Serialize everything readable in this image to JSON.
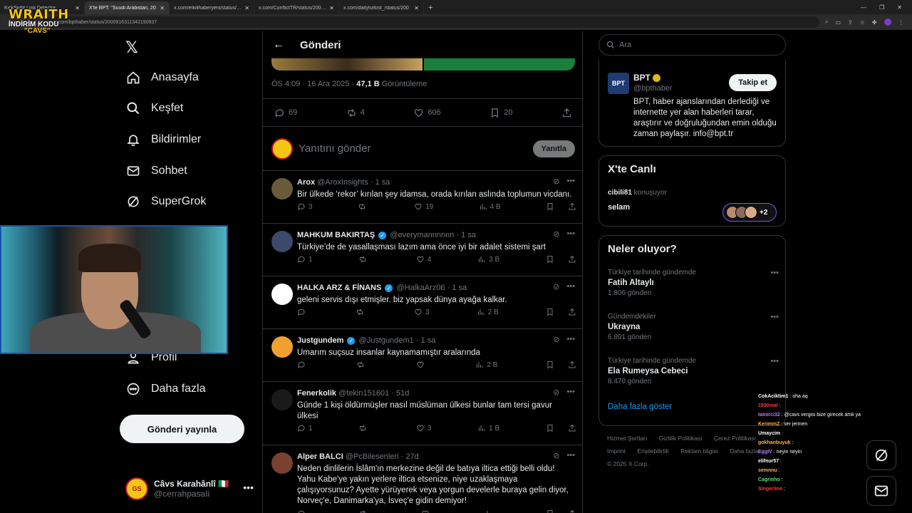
{
  "browser": {
    "tabs": [
      {
        "label": "KickSight Link Detector",
        "active": false
      },
      {
        "label": "X'te BPT: \"Suudi Arabistan, 20",
        "active": true
      },
      {
        "label": "x.com/etkilihaberyeni/status/20",
        "active": false
      },
      {
        "label": "x.com/ConflictTR/status/20008",
        "active": false
      },
      {
        "label": "x.com/dailyturkist_/status/200",
        "active": false
      }
    ],
    "url": "x.com/bpthaber/status/2000916311342190937"
  },
  "overlay": {
    "logo_line1": "WRAITH",
    "logo_line2": "İNDİRİM KODU",
    "logo_line3": "\"CAVS\""
  },
  "nav": {
    "items": [
      {
        "label": "Anasayfa",
        "icon": "home-icon"
      },
      {
        "label": "Keşfet",
        "icon": "search-icon"
      },
      {
        "label": "Bildirimler",
        "icon": "bell-icon"
      },
      {
        "label": "Sohbet",
        "icon": "mail-icon"
      },
      {
        "label": "SuperGrok",
        "icon": "grok-icon"
      },
      {
        "label": "Profil",
        "icon": "person-icon"
      },
      {
        "label": "Daha fazla",
        "icon": "more-circle-icon"
      }
    ],
    "post_button": "Gönderi yayınla",
    "account": {
      "name": "Câvs Karahânlî 🇮🇹",
      "handle": "@cerrahpasaIi"
    }
  },
  "main": {
    "title": "Gönderi",
    "meta": {
      "time": "ÖS 4:09 · 16 Ara 2025 · ",
      "views": "47,1 B",
      "views_label": " Görüntüleme"
    },
    "stats": {
      "replies": "69",
      "reposts": "4",
      "likes": "606",
      "bookmarks": "20"
    },
    "reply_placeholder": "Yanıtını gönder",
    "reply_button": "Yanıtla",
    "replies": [
      {
        "name": "Arox",
        "handle": "@AroxInsights",
        "time": "· 1 sa",
        "text": "Bir ülkede ‘rekor’ kırılan şey idamsa, orada kırılan aslında toplumun vicdanı.",
        "replies": "3",
        "reposts": "",
        "likes": "19",
        "views": "4 B",
        "verified": false
      },
      {
        "name": "MAHKUM BAKIRTAŞ",
        "handle": "@everymannnnnn",
        "time": "· 1 sa",
        "text": "Türkiye’de de yasallaşması lazım ama önce iyi bir adalet sistemi şart",
        "replies": "1",
        "reposts": "",
        "likes": "4",
        "views": "3 B",
        "verified": true
      },
      {
        "name": "HALKA ARZ & FİNANS",
        "handle": "@HalkaArz06",
        "time": "· 1 sa",
        "text": "geleni servis dışı etmişler. biz yapsak dünya ayağa kalkar.",
        "replies": "",
        "reposts": "",
        "likes": "3",
        "views": "2 B",
        "verified": true
      },
      {
        "name": "Justgundem",
        "handle": "@Justgundem1",
        "time": "· 1 sa",
        "text": "Umarım suçsuz insanlar kaynamamıştır aralarında",
        "replies": "",
        "reposts": "",
        "likes": "",
        "views": "2 B",
        "verified": true
      },
      {
        "name": "Fenerkolik",
        "handle": "@tekin151601",
        "time": "· 51d",
        "text": "Günde 1 kişi öldürmüşler nasıl müslüman ülkesi bunlar tam tersi gavur ülkesi",
        "replies": "1",
        "reposts": "",
        "likes": "3",
        "views": "1 B",
        "verified": false
      },
      {
        "name": "Alper BALCI",
        "handle": "@PcBilesenleri",
        "time": "· 27d",
        "text": "Neden dinlilerin İslâm'ın merkezine değil de batıya iltica ettiği belli oldu! Yahu Kabe'ye yakın yerlere iltica etsenize, niye uzaklaşmaya çalışıyorsunuz? Ayette yürüyerek veya yorgun develerle buraya gelin diyor, Norveç'e, Danimarka'ya, İsveç'e gidin demiyor!",
        "replies": "",
        "reposts": "",
        "likes": "",
        "views": "",
        "verified": false
      }
    ]
  },
  "right": {
    "search_placeholder": "Ara",
    "profile": {
      "avatar_text": "BPT",
      "name": "BPT",
      "handle": "@bpthaber",
      "follow": "Takip et",
      "bio": "BPT, haber ajanslarından derlediği ve internette yer alan haberleri tarar, araştırır ve doğruluğundan emin olduğu zaman paylaşır. info@bpt.tr"
    },
    "live": {
      "title": "X'te Canlı",
      "speaker": "cibili81",
      "speaking_label": " konuşuyor",
      "room": "selam",
      "extra": "+2"
    },
    "trends_title": "Neler oluyor?",
    "trends": [
      {
        "context": "Türkiye tarihinde gündemde",
        "title": "Fatih Altaylı",
        "count": "1.806 gönderi"
      },
      {
        "context": "Gündemdekiler",
        "title": "Ukrayna",
        "count": "6.891 gönderi"
      },
      {
        "context": "Türkiye tarihinde gündemde",
        "title": "Ela Rumeysa Cebeci",
        "count": "8.470 gönderi"
      }
    ],
    "show_more": "Daha fazla göster",
    "footer": {
      "l1": [
        "Hizmet Şartları",
        "Gizlilik Politikası",
        "Çerez Politikası"
      ],
      "l2": [
        "Imprint",
        "Erişilebilirlik",
        "Reklam bilgisi",
        "Daha fazla"
      ],
      "copy": "© 2025 X Corp."
    }
  },
  "chat": [
    {
      "user": "CokAciktim1",
      "msg": " : oha aq",
      "color": "#ffffff"
    },
    {
      "user": "1930mal",
      "msg": " : ",
      "color": "#ff3b3b"
    },
    {
      "user": "tamirci32",
      "msg": " : @cavs vergisi bize girecek amk ya",
      "color": "#b57bff"
    },
    {
      "user": "KerimmZ",
      "msg": " : ser jermen",
      "color": "#ffb14a"
    },
    {
      "user": "Umaycim",
      "msg": " : ",
      "color": "#ffffff"
    },
    {
      "user": "gokhanbuyuk",
      "msg": " : ",
      "color": "#ffb14a"
    },
    {
      "user": "EggIV",
      "msg": " : neyin neyin",
      "color": "#b57bff"
    },
    {
      "user": "elifnur57",
      "msg": " : ",
      "color": "#ffffff"
    },
    {
      "user": "semnnu",
      "msg": " : ",
      "color": "#ffb14a"
    },
    {
      "user": "Cagrinho",
      "msg": " : ",
      "color": "#5fe07a"
    },
    {
      "user": "Singerlino",
      "msg": " : ",
      "color": "#ff3b3b"
    }
  ]
}
